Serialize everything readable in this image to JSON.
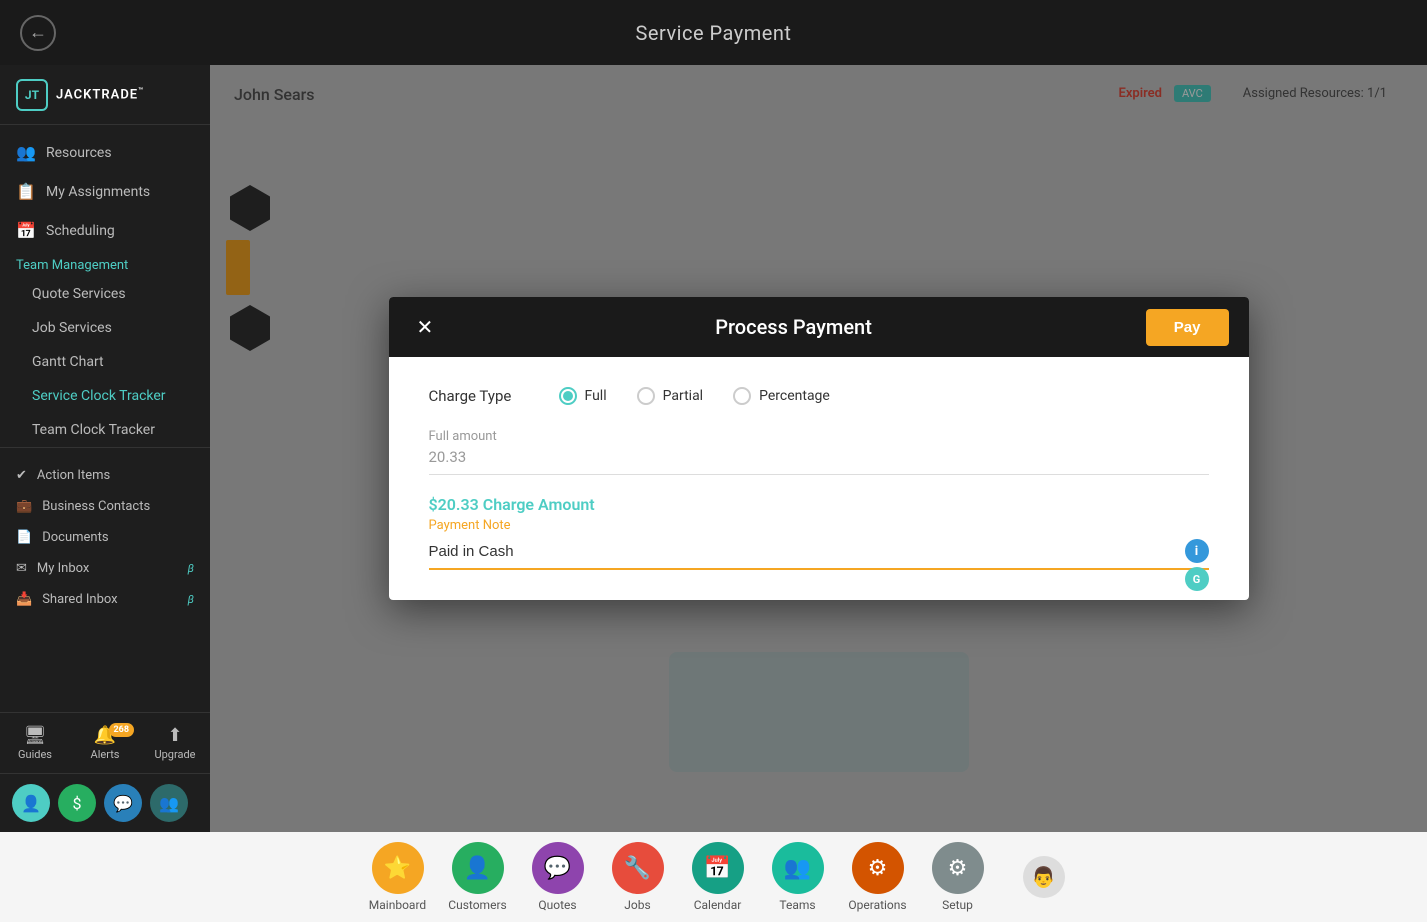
{
  "header": {
    "page_title": "Service Payment",
    "back_button_label": "‹"
  },
  "sidebar": {
    "logo": {
      "icon_text": "JT",
      "name": "JACKTRADE",
      "tm": "™"
    },
    "nav_items": [
      {
        "id": "resources",
        "label": "Resources",
        "icon": "👥"
      },
      {
        "id": "my-assignments",
        "label": "My Assignments",
        "icon": "📋"
      },
      {
        "id": "scheduling",
        "label": "Scheduling",
        "icon": "📅"
      }
    ],
    "section_header": "Team Management",
    "sub_items": [
      {
        "id": "quote-services",
        "label": "Quote Services"
      },
      {
        "id": "job-services",
        "label": "Job Services"
      },
      {
        "id": "gantt-chart",
        "label": "Gantt Chart"
      },
      {
        "id": "service-clock-tracker",
        "label": "Service Clock Tracker",
        "active": true
      },
      {
        "id": "team-clock-tracker",
        "label": "Team Clock Tracker"
      }
    ],
    "bottom_items": [
      {
        "id": "action-items",
        "label": "Action Items",
        "icon": "✔"
      },
      {
        "id": "business-contacts",
        "label": "Business Contacts",
        "icon": "💼"
      },
      {
        "id": "documents",
        "label": "Documents",
        "icon": "📄"
      },
      {
        "id": "my-inbox",
        "label": "My Inbox",
        "icon": "✉",
        "badge": null,
        "beta": "β"
      },
      {
        "id": "shared-inbox",
        "label": "Shared Inbox",
        "icon": "📥",
        "badge": null,
        "beta": "β"
      }
    ],
    "footer_actions": [
      {
        "id": "guides",
        "label": "Guides",
        "icon": "🖥"
      },
      {
        "id": "alerts",
        "label": "Alerts",
        "icon": "🔔",
        "badge": "268"
      },
      {
        "id": "upgrade",
        "label": "Upgrade",
        "icon": "⬆"
      }
    ],
    "footer_icons": [
      {
        "id": "user-icon",
        "icon": "👤",
        "color": "teal"
      },
      {
        "id": "dollar-icon",
        "icon": "$",
        "color": "green"
      },
      {
        "id": "chat-icon",
        "icon": "💬",
        "color": "blue-teal"
      },
      {
        "id": "team-icon",
        "icon": "👥",
        "color": "dark"
      }
    ]
  },
  "background_content": {
    "user_name": "John Sears",
    "tag_expired": "Expired",
    "tag_avc": "AVC",
    "assigned_resources": "Assigned Resources: 1/1"
  },
  "modal": {
    "title": "Process Payment",
    "close_label": "✕",
    "pay_button_label": "Pay",
    "charge_type_label": "Charge Type",
    "charge_options": [
      {
        "id": "full",
        "label": "Full",
        "selected": true
      },
      {
        "id": "partial",
        "label": "Partial",
        "selected": false
      },
      {
        "id": "percentage",
        "label": "Percentage",
        "selected": false
      }
    ],
    "full_amount_label": "Full amount",
    "full_amount_value": "20.33",
    "charge_amount_text": "$20.33 Charge Amount",
    "payment_note_label": "Payment Note",
    "payment_note_value": "Paid in Cash",
    "info_icon": "i",
    "grammar_icon": "G"
  },
  "bottom_nav": {
    "items": [
      {
        "id": "mainboard",
        "label": "Mainboard",
        "icon": "⭐",
        "color": "nav-yellow"
      },
      {
        "id": "customers",
        "label": "Customers",
        "icon": "👤",
        "color": "nav-green"
      },
      {
        "id": "quotes",
        "label": "Quotes",
        "icon": "💬",
        "color": "nav-purple"
      },
      {
        "id": "jobs",
        "label": "Jobs",
        "icon": "🔧",
        "color": "nav-red"
      },
      {
        "id": "calendar",
        "label": "Calendar",
        "icon": "📅",
        "color": "nav-teal-dark"
      },
      {
        "id": "teams",
        "label": "Teams",
        "icon": "👥",
        "color": "nav-teal"
      },
      {
        "id": "operations",
        "label": "Operations",
        "icon": "⚙",
        "color": "nav-orange-dark"
      },
      {
        "id": "setup",
        "label": "Setup",
        "icon": "⚙",
        "color": "nav-gray"
      }
    ]
  }
}
